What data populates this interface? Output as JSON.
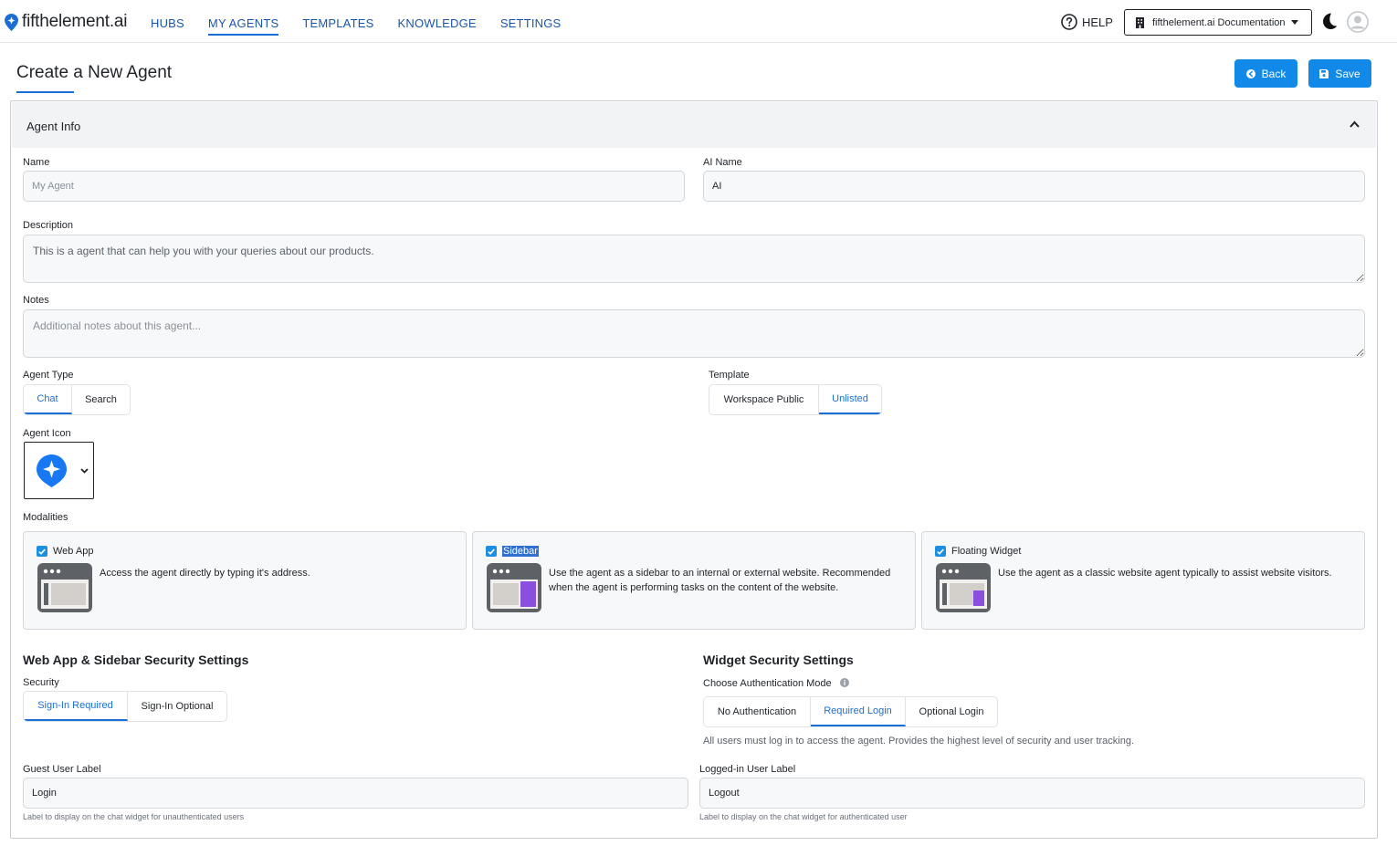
{
  "brand": {
    "name": "fifthelement.ai"
  },
  "nav": {
    "items": [
      {
        "label": "HUBS"
      },
      {
        "label": "MY AGENTS"
      },
      {
        "label": "TEMPLATES"
      },
      {
        "label": "KNOWLEDGE"
      },
      {
        "label": "SETTINGS"
      }
    ],
    "active": "MY AGENTS"
  },
  "topbar": {
    "help_label": "HELP",
    "hub_selector": "fifthelement.ai Documentation"
  },
  "page": {
    "title": "Create a New Agent",
    "back_label": "Back",
    "save_label": "Save"
  },
  "agent_info": {
    "title": "Agent Info",
    "name": {
      "label": "Name",
      "value": "",
      "placeholder": "My Agent"
    },
    "ai_name": {
      "label": "AI Name",
      "value": "AI"
    },
    "description": {
      "label": "Description",
      "value": "This is a agent that can help you with your queries about our products."
    },
    "notes": {
      "label": "Notes",
      "value": "",
      "placeholder": "Additional notes about this agent..."
    },
    "agent_type": {
      "label": "Agent Type",
      "options": [
        "Chat",
        "Search"
      ],
      "selected": "Chat"
    },
    "template": {
      "label": "Template",
      "options": [
        "Workspace Public",
        "Unlisted"
      ],
      "selected": "Unlisted"
    },
    "agent_icon": {
      "label": "Agent Icon"
    },
    "modalities": {
      "label": "Modalities",
      "items": [
        {
          "title": "Web App",
          "checked": true,
          "description": "Access the agent directly by typing it's address."
        },
        {
          "title": "Sidebar",
          "checked": true,
          "description": "Use the agent as a sidebar to an internal or external website. Recommended when the agent is performing tasks on the content of the website."
        },
        {
          "title": "Floating Widget",
          "checked": true,
          "description": "Use the agent as a classic website agent typically to assist website visitors."
        }
      ]
    }
  },
  "web_security": {
    "title": "Web App & Sidebar Security Settings",
    "security_label": "Security",
    "options": [
      "Sign-In Required",
      "Sign-In Optional"
    ],
    "selected": "Sign-In Required",
    "guest_label": {
      "label": "Guest User Label",
      "value": "Login",
      "hint": "Label to display on the chat widget for unauthenticated users"
    }
  },
  "widget_security": {
    "title": "Widget Security Settings",
    "auth_label": "Choose Authentication Mode",
    "options": [
      "No Authentication",
      "Required Login",
      "Optional Login"
    ],
    "selected": "Required Login",
    "auth_hint": "All users must log in to access the agent. Provides the highest level of security and user tracking.",
    "logged_in_label": {
      "label": "Logged-in User Label",
      "value": "Logout",
      "hint": "Label to display on the chat widget for authenticated user"
    }
  },
  "colors": {
    "accent": "#1a6fd6",
    "primary_button": "#1189e8",
    "modality_purple": "#8b4fe0"
  }
}
